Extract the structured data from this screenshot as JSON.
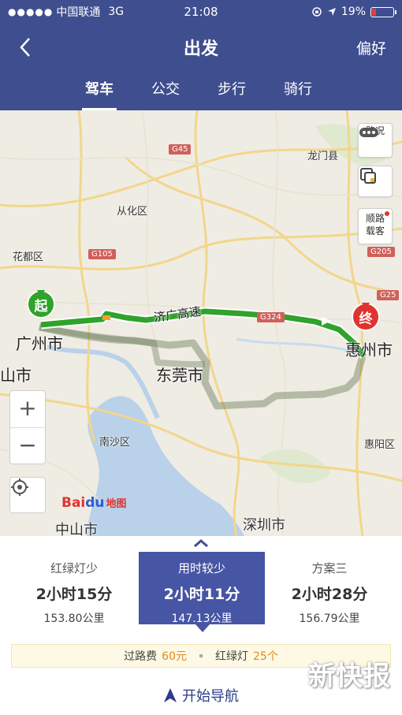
{
  "status_bar": {
    "signal": "●●●●●",
    "carrier": "中国联通",
    "network": "3G",
    "time": "21:08",
    "battery": "19%"
  },
  "nav": {
    "title": "出发",
    "preference_label": "偏好"
  },
  "modes": [
    {
      "label": "驾车",
      "active": true
    },
    {
      "label": "公交",
      "active": false
    },
    {
      "label": "步行",
      "active": false
    },
    {
      "label": "骑行",
      "active": false
    }
  ],
  "map": {
    "labels": {
      "longmen": "龙门县",
      "conghua": "从化区",
      "huadu": "花都区",
      "guangzhou": "广州市",
      "dongguan": "东莞市",
      "huizhou": "惠州市",
      "nansha": "南沙区",
      "huiyang": "惠阳区",
      "shenzhen": "深圳市",
      "zhongshan": "中山市",
      "shan_partial": "山市"
    },
    "highway_name": "济广高速",
    "shields": {
      "g45": "G45",
      "g105": "G105",
      "g324": "G324",
      "g205": "G205",
      "g25": "G25"
    },
    "controls": {
      "traffic": "路况",
      "carpool_line1": "顺路",
      "carpool_line2": "载客",
      "zoom_in": "+",
      "zoom_out": "−"
    },
    "brand": {
      "bai": "Bai",
      "du": "du",
      "ditu": "地图"
    },
    "start_pin": "起",
    "end_pin": "终"
  },
  "route_options": [
    {
      "label": "红绿灯少",
      "time": "2小时15分",
      "distance": "153.80公里",
      "active": false
    },
    {
      "label": "用时较少",
      "time": "2小时11分",
      "distance": "147.13公里",
      "active": true
    },
    {
      "label": "方案三",
      "time": "2小时28分",
      "distance": "156.79公里",
      "active": false
    }
  ],
  "fee_bar": {
    "toll_label": "过路费",
    "toll_value": "60元",
    "lights_label": "红绿灯",
    "lights_value": "25个"
  },
  "start_navigation": "开始导航",
  "watermark": "新快报",
  "colors": {
    "header": "#3f4e8f",
    "route_main": "#2fa32a",
    "route_alt": "#9fb08c",
    "start_pin": "#2fa32a",
    "end_pin": "#e0332f",
    "active_option": "#4655a4",
    "fee_accent": "#e08a1e"
  }
}
